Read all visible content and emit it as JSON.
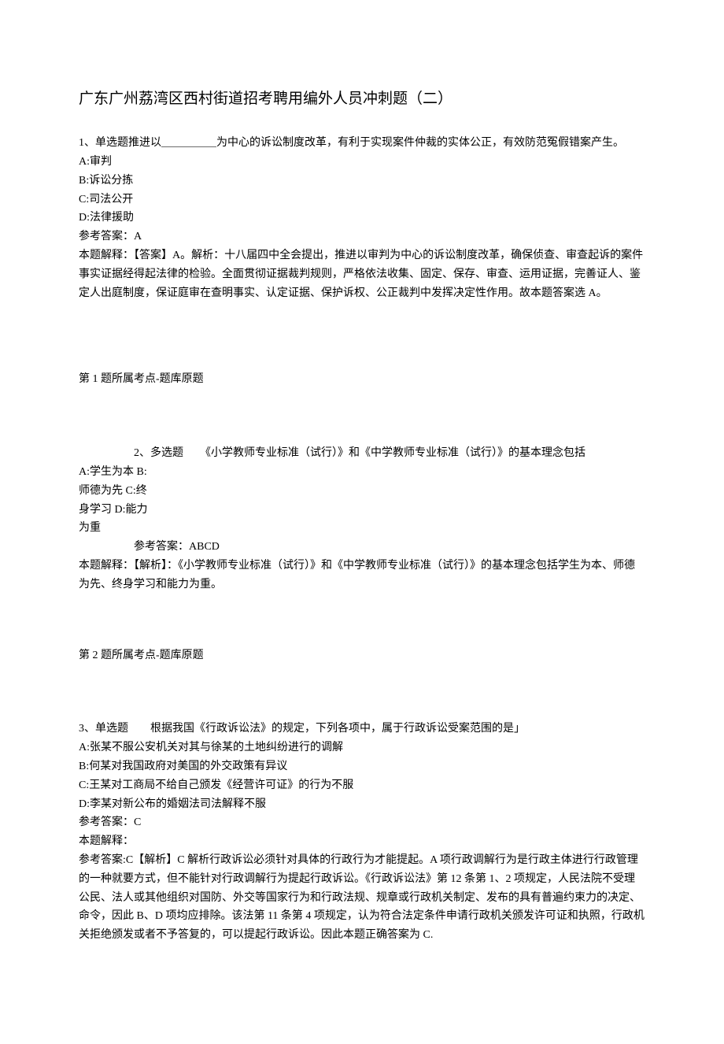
{
  "title": "广东广州荔湾区西村街道招考聘用编外人员冲刺题（二）",
  "q1": {
    "stem": "1、单选题推进以＿＿＿＿＿为中心的诉讼制度改革，有利于实现案件仲裁的实体公正，有效防范冤假错案产生。",
    "optA": "A:审判",
    "optB": "B:诉讼分拣",
    "optC": "C:司法公开",
    "optD": "D:法律援助",
    "ans": "参考答案：A",
    "exp": "本题解释：【答案】A。解析：十八届四中全会提出，推进以审判为中心的诉讼制度改革，确保侦查、审查起诉的案件事实证据经得起法律的检验。全面贯彻证据裁判规则，严格依法收集、固定、保存、审查、运用证据，完善证人、鉴定人出庭制度，保证庭审在查明事实、认定证据、保护诉权、公正裁判中发挥决定性作用。故本题答案选 A。",
    "foot": "第 1 题所属考点-题库原题"
  },
  "q2": {
    "stem": "2、多选题　　《小学教师专业标准（试行）》和《中学教师专业标准（试行）》的基本理念包括",
    "optA": "A:学生为本 B:",
    "optB": "师德为先 C:终",
    "optC": "身学习 D:能力",
    "optD": "为重",
    "ans": "参考答案：ABCD",
    "exp": "本题解释：【解析】：《小学教师专业标准（试行）》和《中学教师专业标准（试行）》的基本理念包括学生为本、师德为先、终身学习和能力为重。",
    "foot": "第 2 题所属考点-题库原题"
  },
  "q3": {
    "stem": "3、单选题　　根据我国《行政诉讼法》的规定，下列各项中，属于行政诉讼受案范围的是」",
    "optA": "A:张某不服公安机关对其与徐某的土地纠纷进行的调解",
    "optB": "B:何某对我国政府对美国的外交政策有异议",
    "optC": "C:王某对工商局不给自己颁发《经营许可证》的行为不服",
    "optD": "D:李某对新公布的婚姻法司法解释不服",
    "ans": "参考答案：C",
    "exp1": "本题解释：",
    "exp2": "参考答案:C【解析】C 解析行政诉讼必须针对具体的行政行为才能提起。A 项行政调解行为是行政主体进行行政管理的一种就要方式，但不能针对行政调解行为提起行政诉讼。《行政诉讼法》第 12 条第 1、2 项规定，人民法院不受理公民、法人或其他组织对国防、外交等国家行为和行政法规、规章或行政机关制定、发布的具有普遍约束力的决定、命令，因此 B、D 项均应排除。该法第 11 条第 4 项规定，认为符合法定条件申请行政机关颁发许可证和执照，行政机关拒绝颁发或者不予答复的，可以提起行政诉讼。因此本题正确答案为 C."
  }
}
